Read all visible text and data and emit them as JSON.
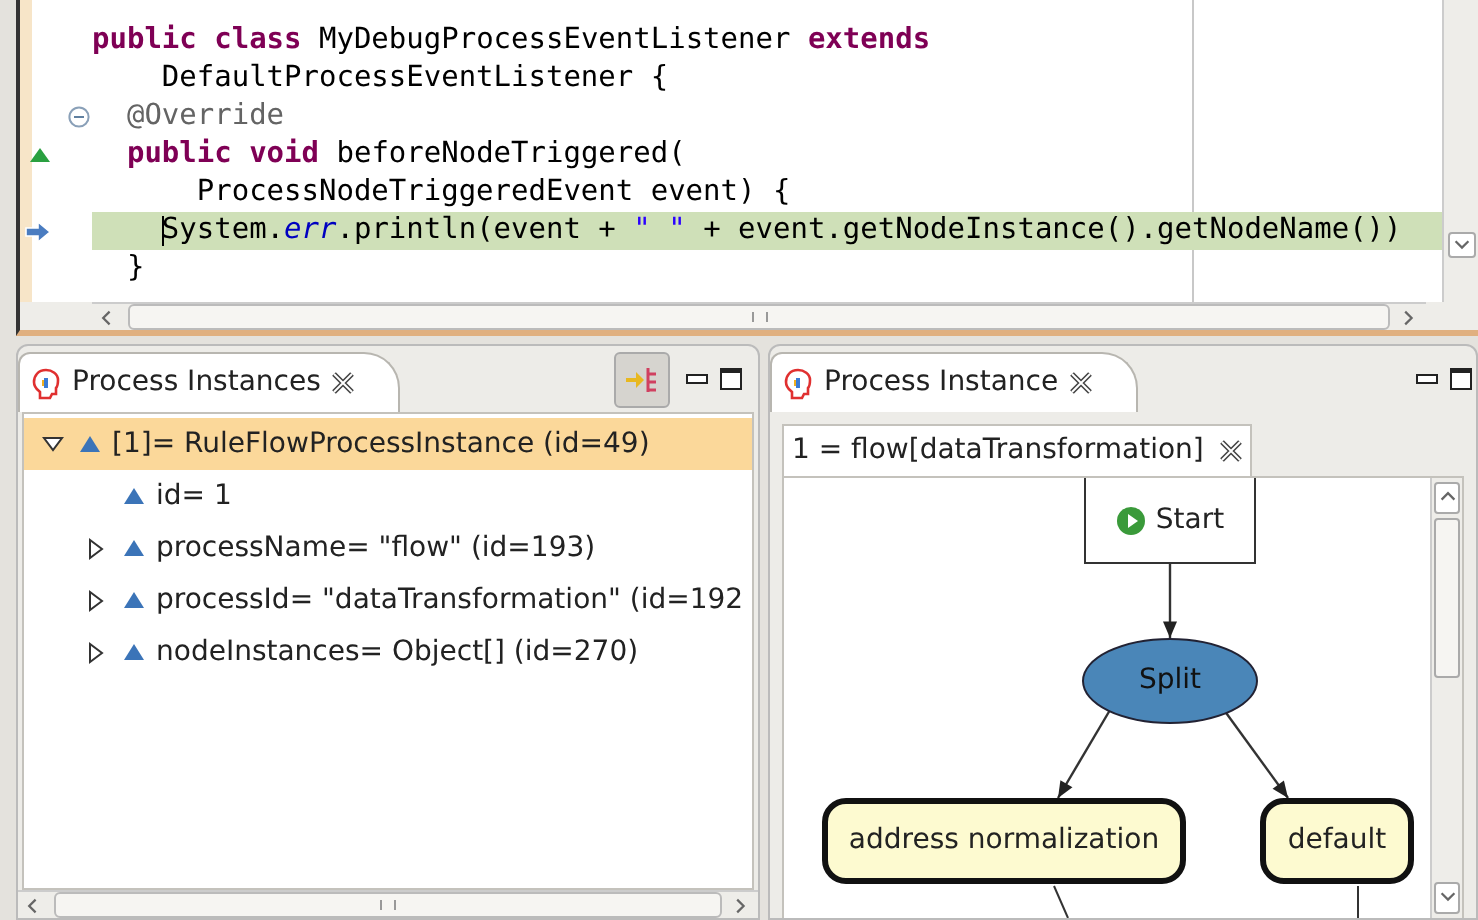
{
  "editor": {
    "lines": [
      {
        "highlighted": false,
        "cursor": false,
        "tokens": [
          {
            "kind": "keyword",
            "text": "public class"
          },
          {
            "kind": "plain",
            "text": " MyDebugProcessEventListener "
          },
          {
            "kind": "keyword",
            "text": "extends"
          }
        ]
      },
      {
        "highlighted": false,
        "cursor": false,
        "tokens": [
          {
            "kind": "plain",
            "text": "    DefaultProcessEventListener {"
          }
        ]
      },
      {
        "highlighted": false,
        "cursor": false,
        "kind": "fold",
        "tokens": [
          {
            "kind": "annotation",
            "text": "  @Override"
          }
        ]
      },
      {
        "highlighted": false,
        "cursor": false,
        "kind": "override",
        "tokens": [
          {
            "kind": "keyword",
            "text": "  public void"
          },
          {
            "kind": "plain",
            "text": " beforeNodeTriggered("
          }
        ]
      },
      {
        "highlighted": false,
        "cursor": false,
        "tokens": [
          {
            "kind": "plain",
            "text": "      ProcessNodeTriggeredEvent event) {"
          }
        ]
      },
      {
        "highlighted": true,
        "cursor": true,
        "kind": "current",
        "tokens": [
          {
            "kind": "plain",
            "text": "    System."
          },
          {
            "kind": "field",
            "text": "err"
          },
          {
            "kind": "plain",
            "text": ".println(event + "
          },
          {
            "kind": "string",
            "text": "\" \""
          },
          {
            "kind": "plain",
            "text": " + event.getNodeInstance().getNodeName())"
          }
        ]
      },
      {
        "highlighted": false,
        "cursor": false,
        "tokens": [
          {
            "kind": "plain",
            "text": "  }"
          }
        ]
      }
    ]
  },
  "instances_view": {
    "title": "Process Instances",
    "items": [
      {
        "label": "[1]= RuleFlowProcessInstance  (id=49)",
        "kind": "branch",
        "expanded": true,
        "selected": true,
        "children": [
          {
            "label": "id= 1",
            "kind": "leaf",
            "selected": false
          },
          {
            "label": "processName= \"flow\" (id=193)",
            "kind": "branch",
            "expanded": false,
            "selected": false
          },
          {
            "label": "processId= \"dataTransformation\" (id=192",
            "kind": "branch",
            "expanded": false,
            "selected": false
          },
          {
            "label": "nodeInstances= Object[]  (id=270)",
            "kind": "branch",
            "expanded": false,
            "selected": false
          }
        ]
      }
    ]
  },
  "instance_view": {
    "title": "Process Instance",
    "editor_tab": {
      "label": "1 = flow[dataTransformation]"
    },
    "diagram": {
      "nodes": [
        {
          "kind": "start",
          "label": "Start"
        },
        {
          "kind": "split",
          "label": "Split"
        },
        {
          "kind": "task",
          "label": "address normalization"
        },
        {
          "kind": "task",
          "label": "default"
        }
      ]
    }
  }
}
